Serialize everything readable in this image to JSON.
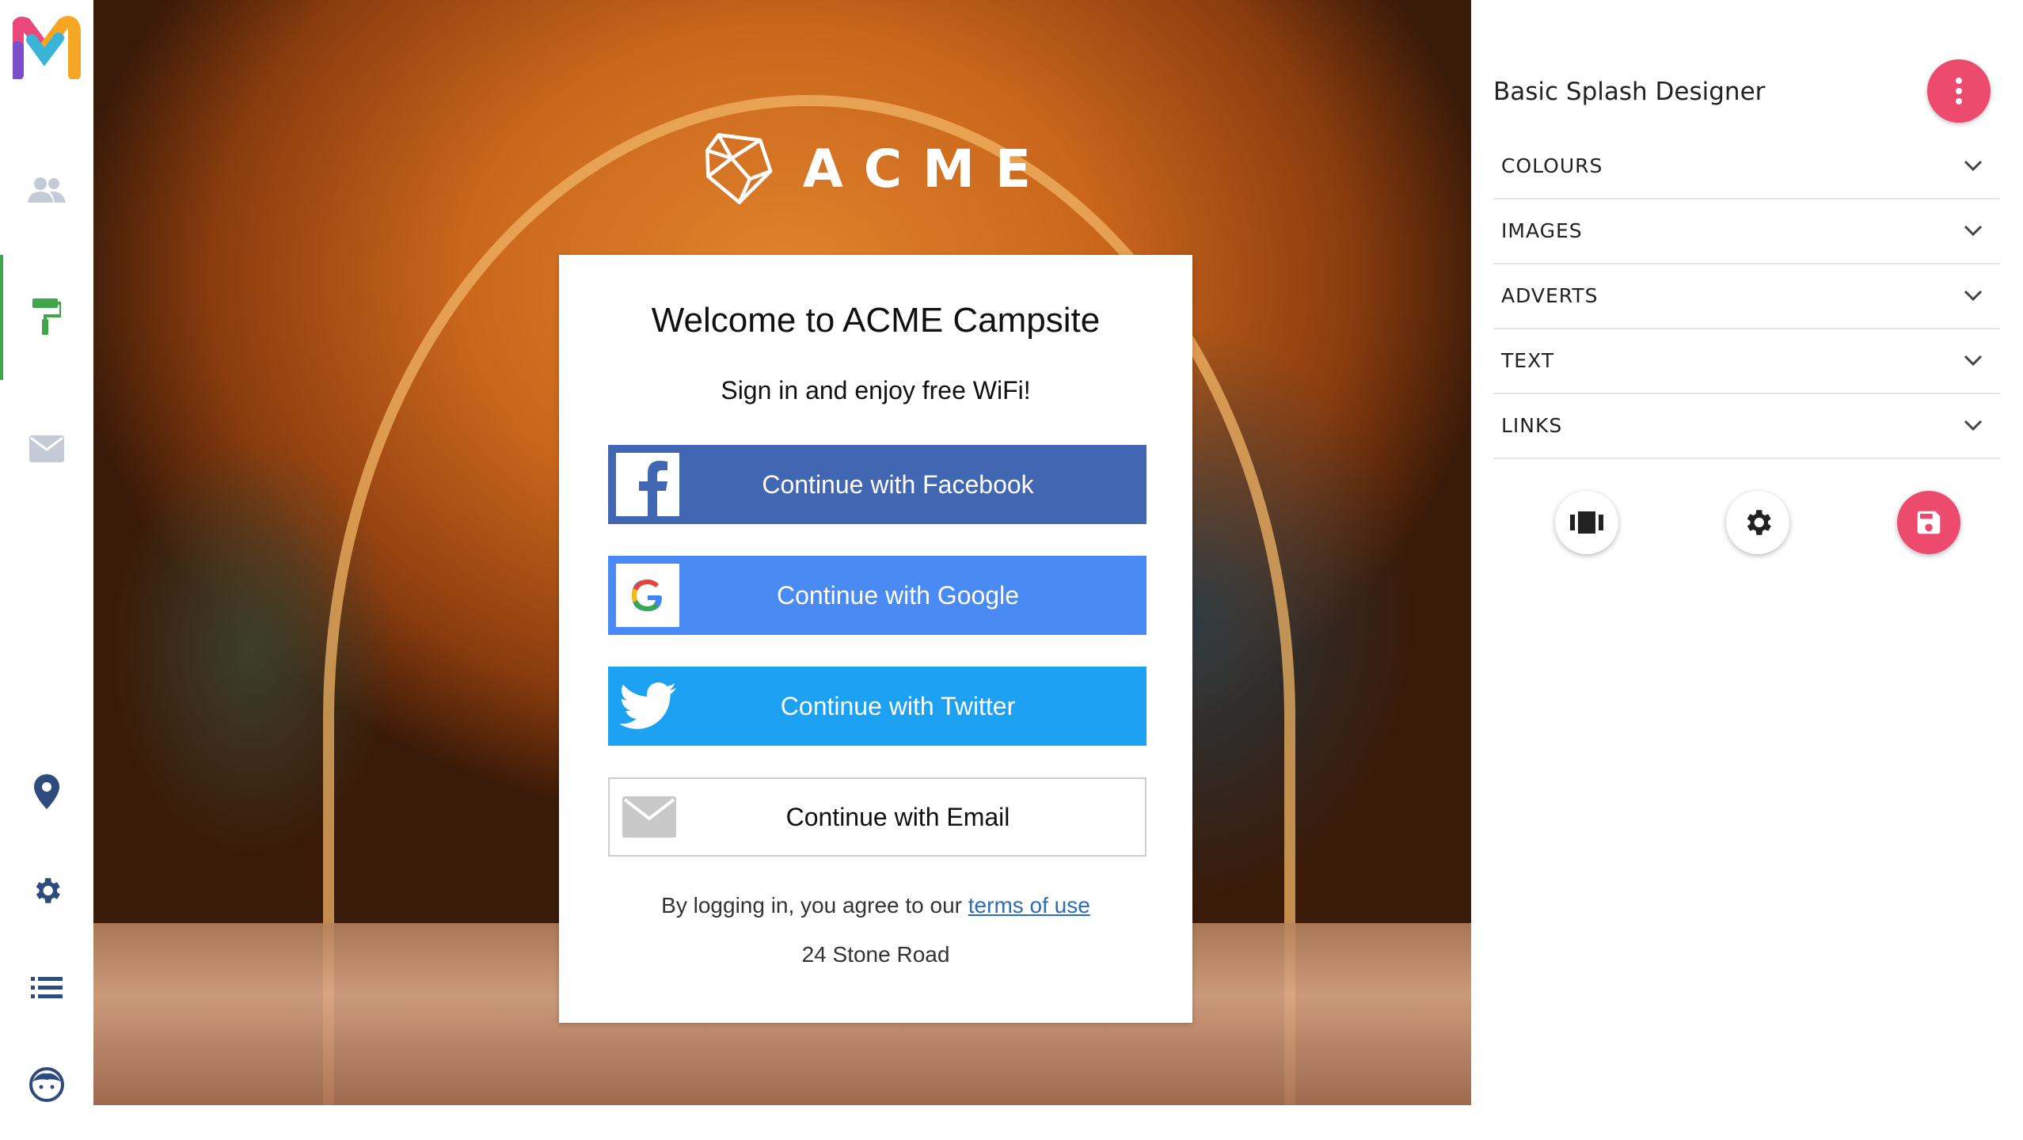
{
  "nav": {
    "logo_icon": "app-logo-m",
    "items": [
      {
        "name": "users-icon",
        "active": false
      },
      {
        "name": "paint-roller-icon",
        "active": true
      },
      {
        "name": "mail-icon",
        "active": false
      },
      {
        "name": "location-pin-icon",
        "active": false
      },
      {
        "name": "gear-icon",
        "active": false
      },
      {
        "name": "list-icon",
        "active": false
      },
      {
        "name": "face-icon",
        "active": false
      }
    ],
    "colors": {
      "icon": "#c5cbd6",
      "icon_dark": "#2d4b7c",
      "active": "#3fa64a"
    }
  },
  "preview": {
    "brand": "ACME",
    "card": {
      "title": "Welcome to ACME Campsite",
      "subtitle": "Sign in and enjoy free WiFi!",
      "buttons": {
        "facebook": "Continue with Facebook",
        "google": "Continue with Google",
        "twitter": "Continue with Twitter",
        "email": "Continue with Email"
      },
      "terms_prefix": "By logging in, you agree to our",
      "terms_link": "terms of use",
      "address": "24 Stone Road"
    },
    "colors": {
      "facebook": "#4267b2",
      "google": "#4a8af4",
      "twitter": "#1da1f2"
    }
  },
  "panel": {
    "title": "Basic Splash Designer",
    "sections": [
      "COLOURS",
      "IMAGES",
      "ADVERTS",
      "TEXT",
      "LINKS"
    ],
    "actions": [
      "carousel-icon",
      "gear-icon",
      "save-icon"
    ],
    "colors": {
      "accent": "#ec4b6e"
    }
  }
}
